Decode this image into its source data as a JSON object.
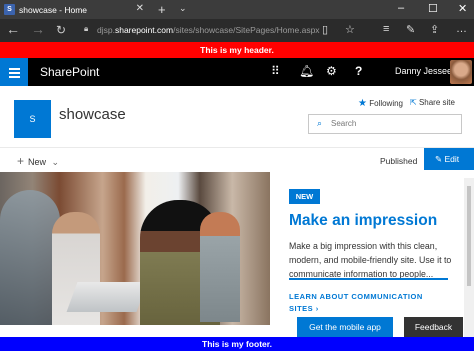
{
  "browser": {
    "tab_title": "showcase - Home",
    "url_prefix": "djsp.",
    "url_domain": "sharepoint.com",
    "url_path": "/sites/showcase/SitePages/Home.aspx"
  },
  "custom_header": "This is my header.",
  "custom_footer": "This is my footer.",
  "suite": {
    "app_name": "SharePoint",
    "user_name": "Danny Jessee"
  },
  "site": {
    "logo_letter": "S",
    "name": "showcase",
    "following_label": "Following",
    "share_label": "Share site",
    "search_placeholder": "Search"
  },
  "commands": {
    "new_label": "New",
    "status": "Published",
    "edit_label": "Edit"
  },
  "hero": {
    "badge": "NEW",
    "title": "Make an impression",
    "body": "Make a big impression with this clean, modern, and mobile-friendly site. Use it to communicate information to people...",
    "link": "LEARN ABOUT COMMUNICATION SITES",
    "link_arrow": "›"
  },
  "buttons": {
    "mobile_app": "Get the mobile app",
    "feedback": "Feedback"
  },
  "colors": {
    "accent": "#0078d4",
    "header_bar": "#ff0000",
    "footer_bar": "#0000ff",
    "suite_bar": "#000000"
  }
}
